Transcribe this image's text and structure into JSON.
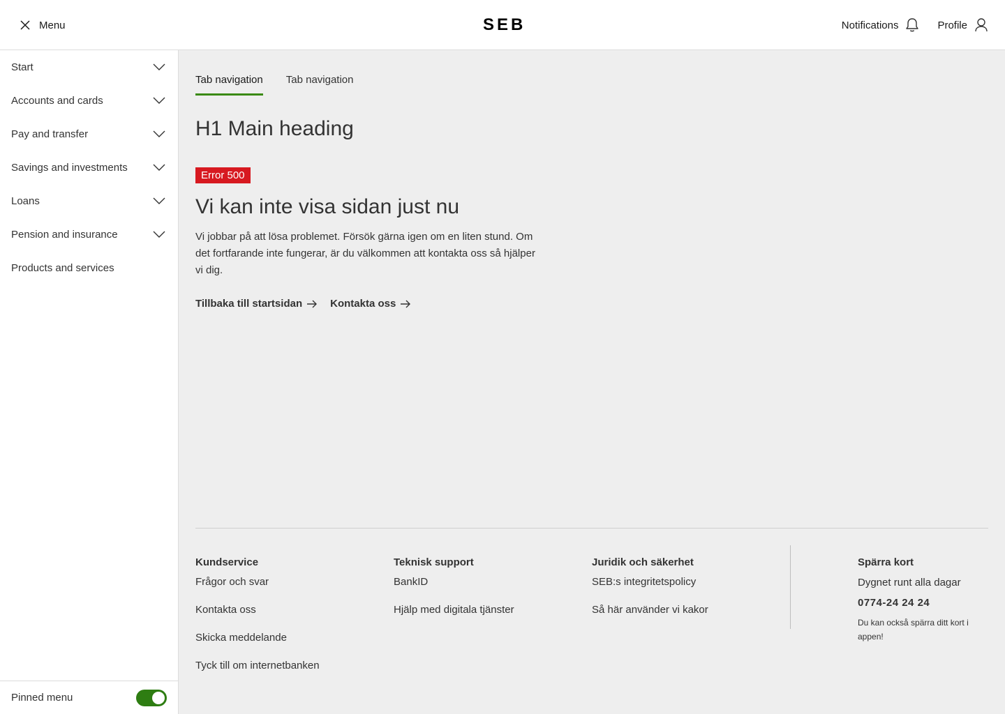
{
  "header": {
    "menu_label": "Menu",
    "logo_left": "S",
    "logo_mid": "E",
    "logo_right": "B",
    "notifications_label": "Notifications",
    "profile_label": "Profile"
  },
  "sidebar": {
    "items": [
      {
        "label": "Start",
        "expandable": true
      },
      {
        "label": "Accounts and cards",
        "expandable": true
      },
      {
        "label": "Pay and transfer",
        "expandable": true
      },
      {
        "label": "Savings and investments",
        "expandable": true
      },
      {
        "label": "Loans",
        "expandable": true
      },
      {
        "label": "Pension and insurance",
        "expandable": true
      },
      {
        "label": "Products and services",
        "expandable": false
      }
    ],
    "pinned_label": "Pinned menu",
    "pinned_on": true
  },
  "main": {
    "tabs": [
      {
        "label": "Tab navigation",
        "active": true
      },
      {
        "label": "Tab navigation",
        "active": false
      }
    ],
    "heading": "H1 Main heading",
    "error_badge": "Error 500",
    "error_title": "Vi kan inte visa sidan just nu",
    "error_text": "Vi jobbar på att lösa problemet. Försök gärna igen om en liten stund. Om det fortfarande inte fungerar, är du välkommen att kontakta oss så hjälper vi dig.",
    "links": [
      {
        "label": "Tillbaka till startsidan"
      },
      {
        "label": "Kontakta oss"
      }
    ]
  },
  "footer": {
    "columns": [
      {
        "title": "Kundservice",
        "links": [
          "Frågor och svar",
          "Kontakta oss",
          "Skicka meddelande",
          "Tyck till om internetbanken"
        ]
      },
      {
        "title": "Teknisk support",
        "links": [
          "BankID",
          "Hjälp med digitala tjänster"
        ]
      },
      {
        "title": "Juridik och säkerhet",
        "links": [
          "SEB:s integritetspolicy",
          "Så här använder vi kakor"
        ]
      }
    ],
    "block_card": {
      "title": "Spärra kort",
      "availability": "Dygnet runt alla dagar",
      "phone": "0774-24 24 24",
      "note": "Du kan också spärra ditt kort i appen!"
    }
  },
  "colors": {
    "accent_green": "#3a8a12",
    "toggle_green": "#2e7d12",
    "error_red": "#d71920",
    "background": "#eeeeee"
  }
}
